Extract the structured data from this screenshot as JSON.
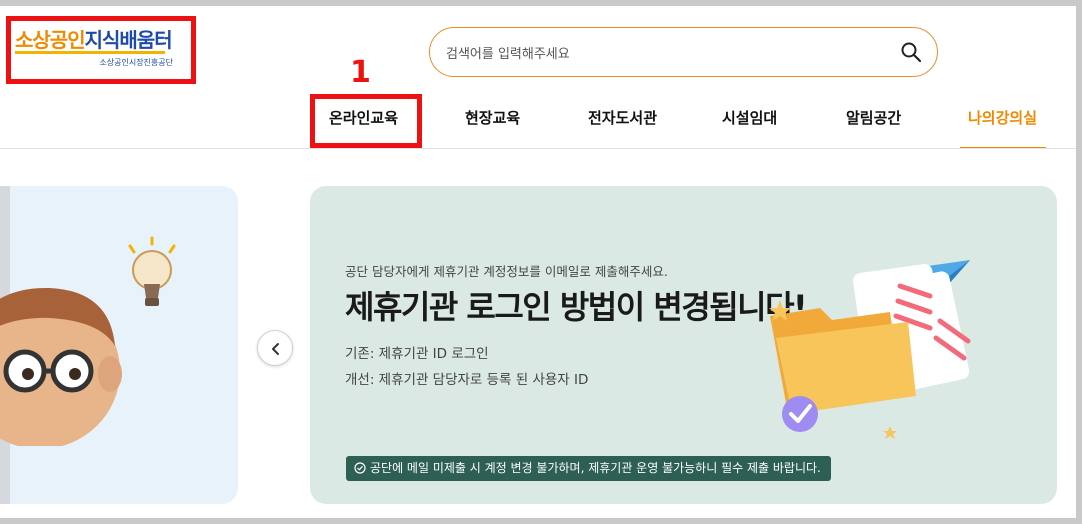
{
  "header": {
    "logo": {
      "part1": "소상공인",
      "part2": "지식배움터",
      "sub": "소상공인시장진흥공단"
    },
    "search": {
      "placeholder": "검색어를 입력해주세요"
    },
    "annotation_number": "1",
    "nav": [
      {
        "label": "온라인교육",
        "active": false
      },
      {
        "label": "현장교육",
        "active": false
      },
      {
        "label": "전자도서관",
        "active": false
      },
      {
        "label": "시설임대",
        "active": false
      },
      {
        "label": "알림공간",
        "active": false
      },
      {
        "label": "나의강의실",
        "active": true
      }
    ]
  },
  "banner": {
    "subtitle": "공단 담당자에게 제휴기관 계정정보를 이메일로 제출해주세요.",
    "title": "제휴기관 로그인 방법이 변경됩니다!",
    "line1": "기존: 제휴기관 ID 로그인",
    "line2": "개선: 제휴기관 담당자로 등록 된 사용자 ID",
    "notice": "공단에 메일 미제출 시 계정 변경 불가하며, 제휴기관 운영 불가능하니 필수 제출 바랍니다."
  },
  "icons": [
    "search-icon",
    "chevron-left-icon",
    "check-circle-icon",
    "folder-illustration",
    "lightbulb-illustration",
    "character-illustration"
  ],
  "colors": {
    "accent": "#f08a00",
    "highlight": "#ee1111",
    "banner_bg": "#dbe9e5",
    "notice_bg": "#2d5f54"
  }
}
